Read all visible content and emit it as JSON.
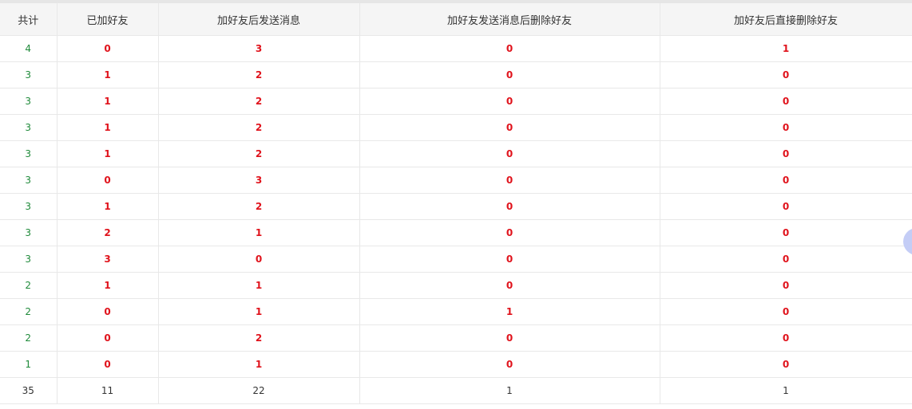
{
  "colors": {
    "total": "#1f8a3a",
    "count": "#e0131c",
    "header_bg": "#f5f5f5",
    "border": "#e8e8e8"
  },
  "table": {
    "headers": [
      "共计",
      "已加好友",
      "加好友后发送消息",
      "加好友发送消息后删除好友",
      "加好友后直接删除好友"
    ],
    "rows": [
      [
        "4",
        "0",
        "3",
        "0",
        "1"
      ],
      [
        "3",
        "1",
        "2",
        "0",
        "0"
      ],
      [
        "3",
        "1",
        "2",
        "0",
        "0"
      ],
      [
        "3",
        "1",
        "2",
        "0",
        "0"
      ],
      [
        "3",
        "1",
        "2",
        "0",
        "0"
      ],
      [
        "3",
        "0",
        "3",
        "0",
        "0"
      ],
      [
        "3",
        "1",
        "2",
        "0",
        "0"
      ],
      [
        "3",
        "2",
        "1",
        "0",
        "0"
      ],
      [
        "3",
        "3",
        "0",
        "0",
        "0"
      ],
      [
        "2",
        "1",
        "1",
        "0",
        "0"
      ],
      [
        "2",
        "0",
        "1",
        "1",
        "0"
      ],
      [
        "2",
        "0",
        "2",
        "0",
        "0"
      ],
      [
        "1",
        "0",
        "1",
        "0",
        "0"
      ]
    ],
    "summary": [
      "35",
      "11",
      "22",
      "1",
      "1"
    ]
  }
}
